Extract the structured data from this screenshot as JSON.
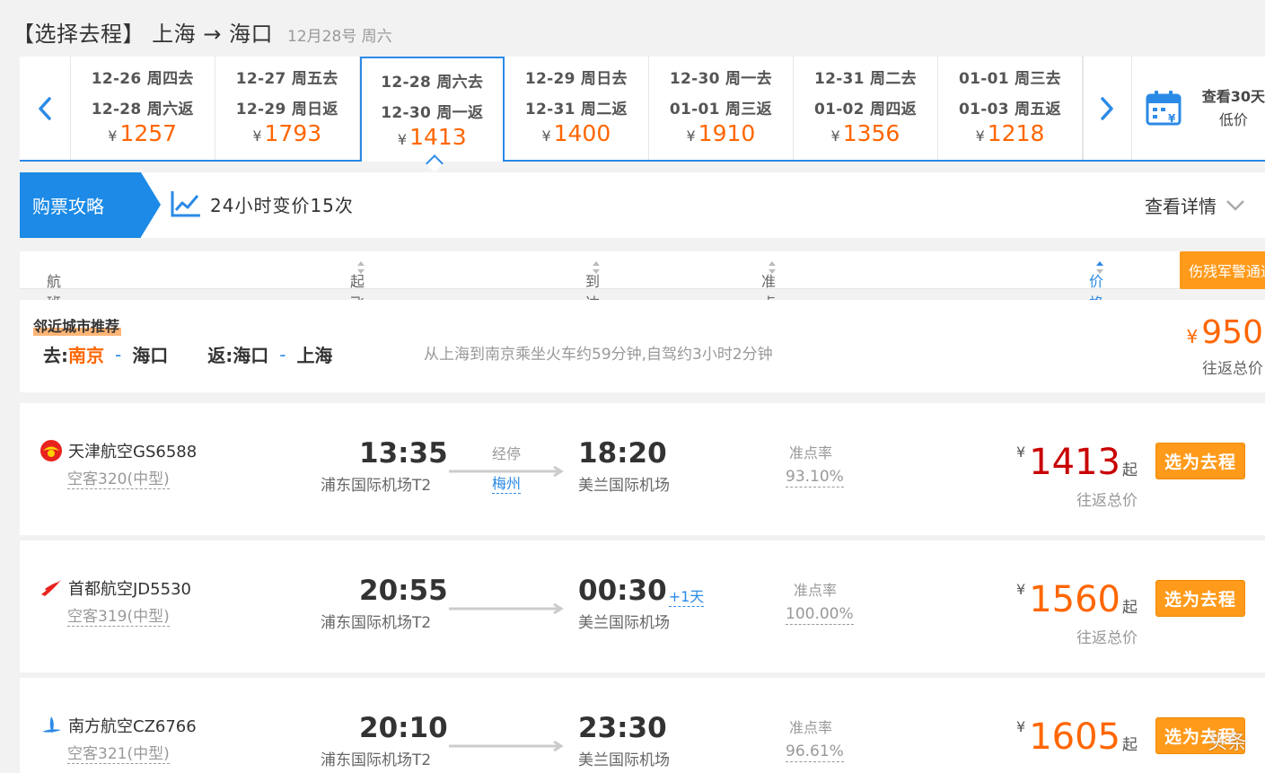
{
  "header": {
    "title": "【选择去程】 上海 → 海口",
    "date": "12月28号 周六"
  },
  "dates": [
    {
      "go": "12-26 周四去",
      "ret": "12-28 周六返",
      "price": "1257"
    },
    {
      "go": "12-27 周五去",
      "ret": "12-29 周日返",
      "price": "1793"
    },
    {
      "go": "12-28 周六去",
      "ret": "12-30 周一返",
      "price": "1413"
    },
    {
      "go": "12-29 周日去",
      "ret": "12-31 周二返",
      "price": "1400"
    },
    {
      "go": "12-30 周一去",
      "ret": "01-01 周三返",
      "price": "1910"
    },
    {
      "go": "12-31 周二去",
      "ret": "01-02 周四返",
      "price": "1356"
    },
    {
      "go": "01-01 周三去",
      "ret": "01-03 周五返",
      "price": "1218"
    }
  ],
  "currency": "¥",
  "calendar": {
    "line1": "查看30天",
    "line2": "低价"
  },
  "guide": {
    "tag": "购票攻略",
    "trend": "24小时变价15次",
    "details": "查看详情"
  },
  "columns": {
    "flight_info": "航班信息",
    "dep_time": "起飞时间",
    "arr_time": "到达时间",
    "ontime": "准点率",
    "price": "价格",
    "military": "伤残军警通道"
  },
  "recommend": {
    "title": "邻近城市推荐",
    "go_label": "去:",
    "go_from": "南京",
    "go_to": "海口",
    "ret_label": "返:",
    "ret_from": "海口",
    "ret_to": "上海",
    "dash": "-",
    "note": "从上海到南京乘坐火车约59分钟,自驾约3小时2分钟",
    "price": "950",
    "price_sub": "往返总价"
  },
  "flights": [
    {
      "airline": "天津航空GS6588",
      "model": "空客320(中型)",
      "dep_time": "13:35",
      "dep_airport": "浦东国际机场T2",
      "stop_label": "经停",
      "stop_city": "梅州",
      "arr_time": "18:20",
      "arr_plus": "",
      "arr_airport": "美兰国际机场",
      "ontime_label": "准点率",
      "ontime": "93.10%",
      "price": "1413",
      "price_color": "#c80000",
      "qi": "起",
      "price_sub": "往返总价",
      "btn": "选为去程"
    },
    {
      "airline": "首都航空JD5530",
      "model": "空客319(中型)",
      "dep_time": "20:55",
      "dep_airport": "浦东国际机场T2",
      "stop_label": "",
      "stop_city": "",
      "arr_time": "00:30",
      "arr_plus": "+1天",
      "arr_airport": "美兰国际机场",
      "ontime_label": "准点率",
      "ontime": "100.00%",
      "price": "1560",
      "price_color": "#ff6600",
      "qi": "起",
      "price_sub": "往返总价",
      "btn": "选为去程"
    },
    {
      "airline": "南方航空CZ6766",
      "model": "空客321(中型)",
      "dep_time": "20:10",
      "dep_airport": "浦东国际机场T2",
      "stop_label": "",
      "stop_city": "",
      "arr_time": "23:30",
      "arr_plus": "",
      "arr_airport": "美兰国际机场",
      "ontime_label": "准点率",
      "ontime": "96.61%",
      "price": "1605",
      "price_color": "#ff6600",
      "qi": "起",
      "price_sub": "往返总价",
      "btn": "选为去程"
    }
  ],
  "watermark": "头条"
}
